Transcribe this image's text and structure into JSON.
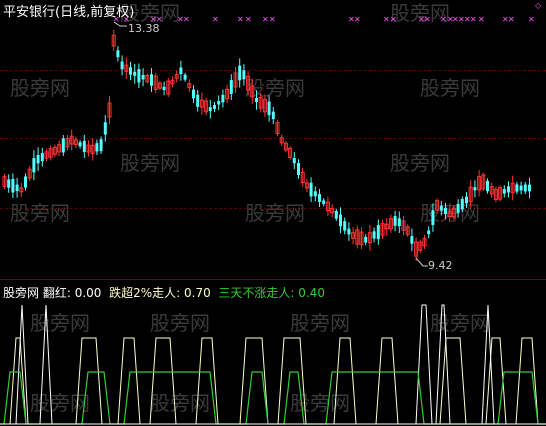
{
  "title": "平安银行(日线,前复权)",
  "price_labels": {
    "high": "13.38",
    "low": "9.42"
  },
  "indicator": {
    "name": "翻红",
    "items": [
      {
        "label": "翻红:",
        "value": "0.00",
        "color": "#ffffff"
      },
      {
        "label": "跌超2%走人:",
        "value": "0.70",
        "color": "#ffffcc"
      },
      {
        "label": "三天不涨走人:",
        "value": "0.40",
        "color": "#33cc33"
      }
    ]
  },
  "watermark": "股旁网",
  "colors": {
    "background": "#000000",
    "up": "#ff3333",
    "down": "#54ffff",
    "marker": "#ff55ff",
    "signal_white": "#ffffff",
    "signal_yellow": "#ffffcc",
    "signal_green": "#33cc33"
  }
}
